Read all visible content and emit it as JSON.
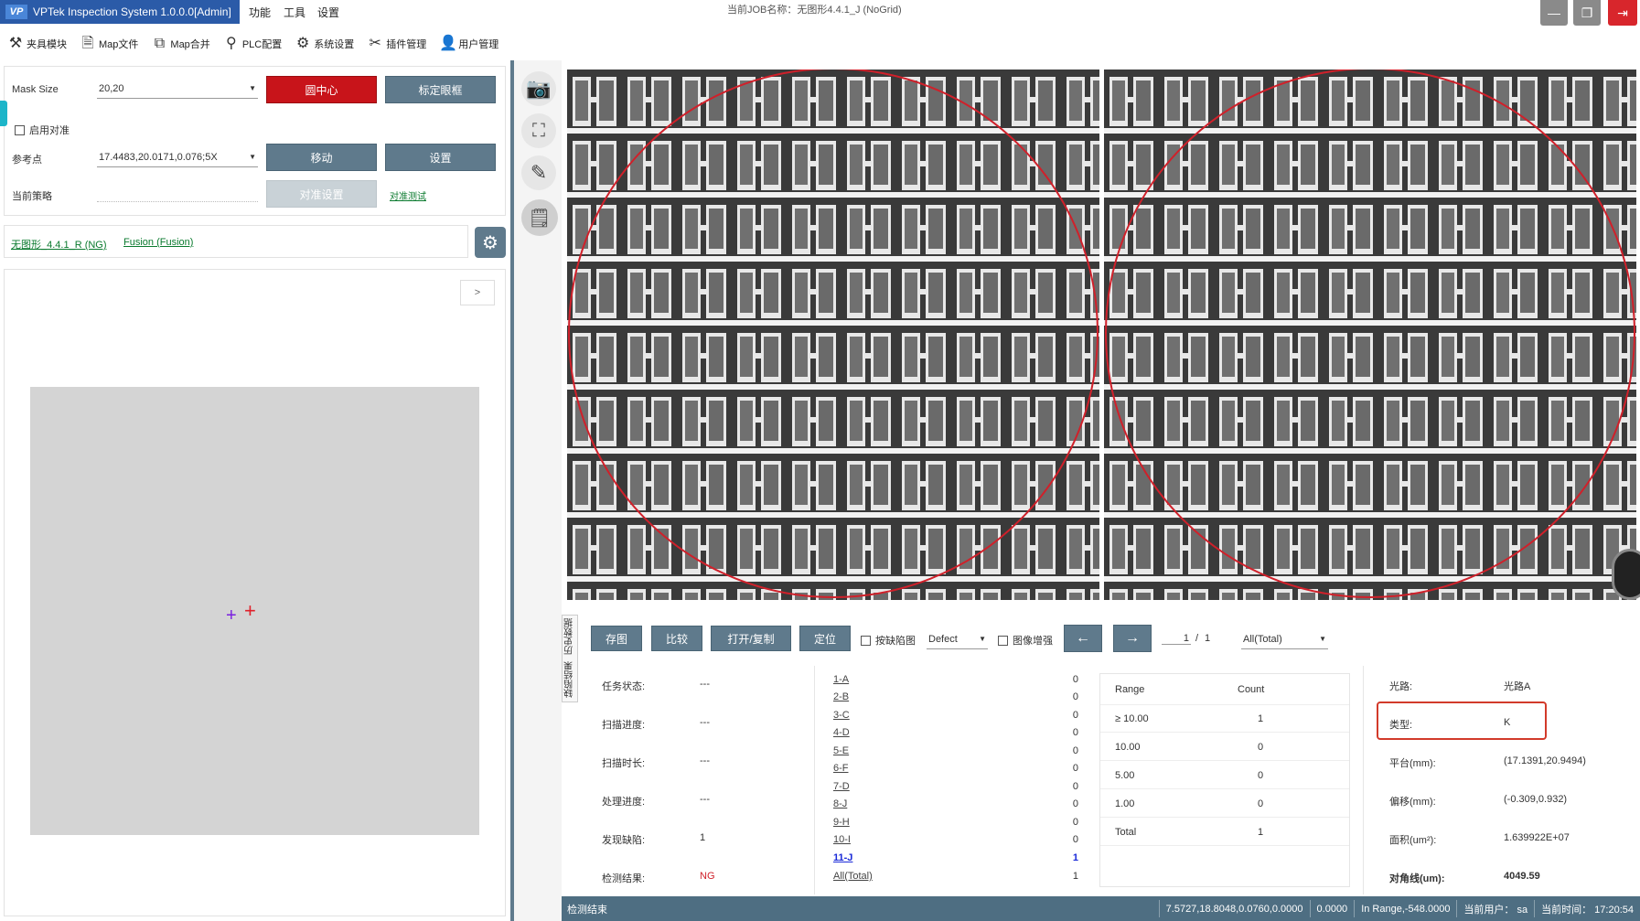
{
  "titlebar": {
    "app_title": "VPTek Inspection System 1.0.0.0[Admin]",
    "logo_text": "VP",
    "menus": [
      "功能",
      "工具",
      "设置"
    ],
    "job_label": "当前JOB名称：无图形4.4.1_J (NoGrid)"
  },
  "toolbar": {
    "items": [
      "夹具模块",
      "Map文件",
      "Map合并",
      "PLC配置",
      "系统设置",
      "插件管理",
      "用户管理"
    ]
  },
  "settings": {
    "mask_size_label": "Mask Size",
    "mask_size_value": "20,20",
    "circle_center_btn": "圆中心",
    "calib_frame_btn": "标定眼框",
    "enable_align_label": "启用对准",
    "ref_point_label": "参考点",
    "ref_point_value": "17.4483,20.0171,0.076;5X",
    "move_btn": "移动",
    "set_btn": "设置",
    "current_strategy_label": "当前策略",
    "align_settings_btn": "对准设置",
    "align_test_link": "对准测试"
  },
  "recipe": {
    "link1": "无图形_4.4.1_R (NG)",
    "link2": "Fusion (Fusion)"
  },
  "map": {
    "expand_label": ">"
  },
  "side_tabs": {
    "tab1": "缺陷结果",
    "tab2": "历史数据"
  },
  "bottom": {
    "save_img_btn": "存图",
    "compare_btn": "比较",
    "open_copy_btn": "打开/复制",
    "locate_btn": "定位",
    "by_defect_label": "按缺陷图",
    "defect_select": "Defect",
    "enhance_label": "图像增强",
    "prev_btn": "←",
    "next_btn": "→",
    "page_current": "1",
    "page_sep": "/",
    "page_total": "1",
    "filter_select": "All(Total)"
  },
  "status": [
    {
      "label": "任务状态:",
      "value": "---"
    },
    {
      "label": "扫描进度:",
      "value": "---"
    },
    {
      "label": "扫描时长:",
      "value": "---"
    },
    {
      "label": "处理进度:",
      "value": "---"
    },
    {
      "label": "发现缺陷:",
      "value": "1"
    },
    {
      "label": "检测结果:",
      "value": "NG"
    }
  ],
  "defects": [
    {
      "name": "1-A",
      "count": "0"
    },
    {
      "name": "2-B",
      "count": "0"
    },
    {
      "name": "3-C",
      "count": "0"
    },
    {
      "name": "4-D",
      "count": "0"
    },
    {
      "name": "5-E",
      "count": "0"
    },
    {
      "name": "6-F",
      "count": "0"
    },
    {
      "name": "7-D",
      "count": "0"
    },
    {
      "name": "8-J",
      "count": "0"
    },
    {
      "name": "9-H",
      "count": "0"
    },
    {
      "name": "10-I",
      "count": "0"
    },
    {
      "name": "11-J",
      "count": "1"
    },
    {
      "name": "All(Total)",
      "count": "1"
    }
  ],
  "range_table": {
    "header_range": "Range",
    "header_count": "Count",
    "rows": [
      {
        "range": "≥ 10.00",
        "count": "1"
      },
      {
        "range": "10.00",
        "count": "0"
      },
      {
        "range": "5.00",
        "count": "0"
      },
      {
        "range": "1.00",
        "count": "0"
      },
      {
        "range": "Total",
        "count": "1"
      }
    ]
  },
  "info": [
    {
      "label": "光路:",
      "value": "光路A"
    },
    {
      "label": "类型:",
      "value": "K"
    },
    {
      "label": "平台(mm):",
      "value": "(17.1391,20.9494)"
    },
    {
      "label": "偏移(mm):",
      "value": "(-0.309,0.932)"
    },
    {
      "label": "面积(um²):",
      "value": "1.639922E+07"
    },
    {
      "label": "对角线(um):",
      "value": "4049.59"
    }
  ],
  "statusbar": {
    "left": "检测结束",
    "coords": "7.5727,18.8048,0.0760,0.0000",
    "value": "0.0000",
    "range": "In Range,-548.0000",
    "user": "当前用户： sa",
    "time": "当前时间： 17:20:54"
  },
  "colors": {
    "title_blue": "#2b5ba8",
    "button_gray": "#5f7a8c",
    "button_red": "#c8141a",
    "ng_red": "#d0202a",
    "highlight_box": "#d23a2a",
    "status_bar": "#4e6e82"
  }
}
